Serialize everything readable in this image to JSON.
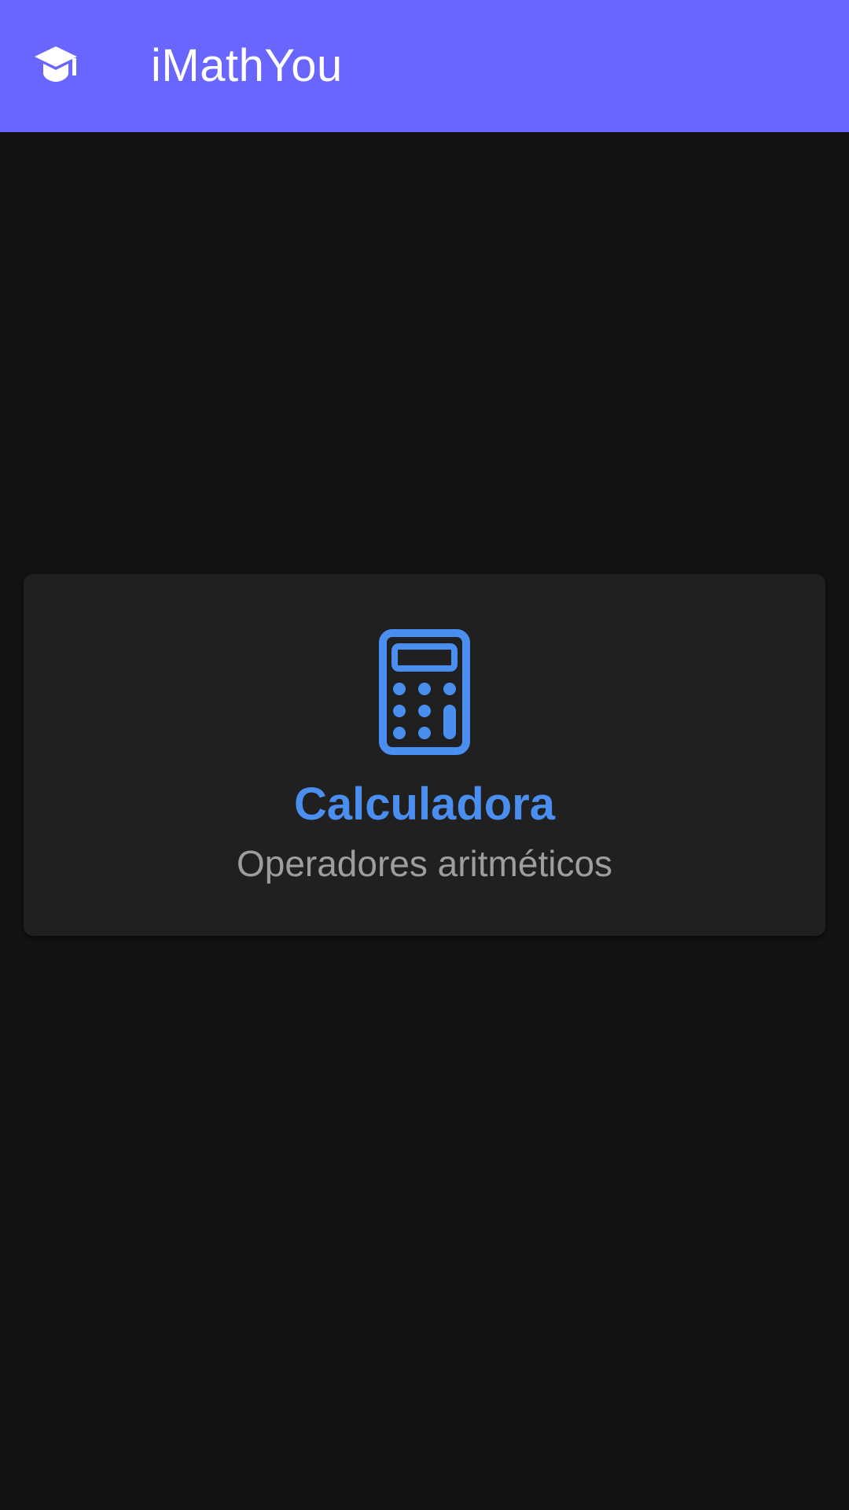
{
  "app_bar": {
    "icon": "graduation-cap-icon",
    "title": "iMathYou",
    "background_color": "#6866ff",
    "text_color": "#ffffff"
  },
  "main": {
    "cards": [
      {
        "icon": "calculator-icon",
        "title": "Calculadora",
        "subtitle": "Operadores aritméticos",
        "accent_color": "#4a8ef0"
      }
    ]
  },
  "theme": {
    "background": "#121212",
    "card_background": "#202020"
  }
}
